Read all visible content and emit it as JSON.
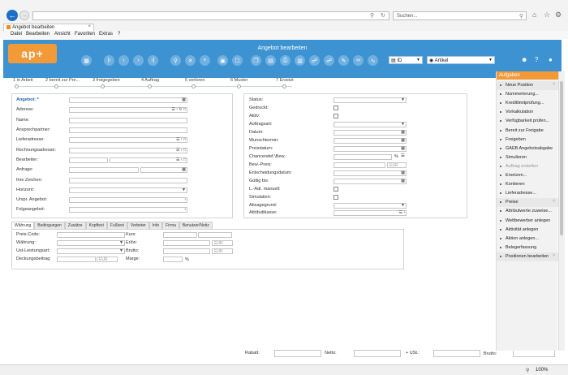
{
  "browser": {
    "search_placeholder": "Suchen...",
    "tab_title": "Angebot bearbeiten",
    "menu": [
      "Datei",
      "Bearbeiten",
      "Ansicht",
      "Favoriten",
      "Extras",
      "?"
    ],
    "zoom": "100%"
  },
  "app": {
    "logo": "ap+",
    "title": "Angebot bearbeiten",
    "id_select": "ID",
    "artikel_select": "Artikel",
    "colors": {
      "header": "#3d93d1",
      "accent": "#f29a38"
    }
  },
  "steps": [
    "1 in Arbeit",
    "2 bereit zur Pre...",
    "3 freigegeben",
    "4 Auftrag",
    "5 verloren",
    "6 Muster",
    "7 Ersetzt"
  ],
  "left_form": {
    "labels": [
      "Angebot: *",
      "Adresse:",
      "Name:",
      "Ansprechpartner:",
      "Lieferadresse:",
      "Rechnungsadresse:",
      "Bearbeiter:",
      "Anfrage:",
      "Ihre Zeichen:",
      "Horizont:",
      "Urspr. Angebot:",
      "Folgeangebot:"
    ]
  },
  "right_form": {
    "labels": [
      "Status:",
      "Gedruckt:",
      "Aktiv:",
      "Auftragsart:",
      "Datum:",
      "Wunschtermin:",
      "Preisdatum:",
      "Chancendef.\\Bew.:",
      "Bew.-Preis:",
      "Entscheidungsdatum:",
      "Gültig bis:",
      "L.-Adr. manuell:",
      "Simulation:",
      "Absagegrund:",
      "Attributklasse:"
    ],
    "percent": "%",
    "currency": "EUR"
  },
  "tabs": [
    "Währung",
    "Bedingungen",
    "Zusätze",
    "Kopftext",
    "Fußtext",
    "Verbeter",
    "Info",
    "Firma",
    "Benutzer/Notiz"
  ],
  "waehrung": {
    "left_labels": [
      "Preis-Code:",
      "Währung:",
      "Ust-Leistungsart:",
      "Deckungsbeitrag:"
    ],
    "right_labels": [
      "Kurs:",
      "Erlös:",
      "Brutto:",
      "Marge:"
    ],
    "currency": "EUR",
    "percent": "%"
  },
  "totals": {
    "labels": [
      "Rabatt:",
      "Netto:",
      "+ USt.:",
      "Brutto:"
    ]
  },
  "sidebar": {
    "title": "Aufgaben",
    "items": [
      {
        "label": "Neue Position",
        "type": "sec"
      },
      {
        "label": "Nummerierung...",
        "type": "item"
      },
      {
        "label": "Kreditlimitprüfung...",
        "type": "item"
      },
      {
        "label": "Vorkalkulation",
        "type": "item"
      },
      {
        "label": "Verfügbarkeit prüfen...",
        "type": "item"
      },
      {
        "label": "Bereit zur Freigabe",
        "type": "item"
      },
      {
        "label": "Freigeben",
        "type": "item"
      },
      {
        "label": "GAEB Angebotsabgabe",
        "type": "item"
      },
      {
        "label": "Simulieren",
        "type": "item"
      },
      {
        "label": "Auftrag erstellen",
        "type": "dis"
      },
      {
        "label": "Ersetzen...",
        "type": "item"
      },
      {
        "label": "Kontieren",
        "type": "item"
      },
      {
        "label": "Lieferadresse...",
        "type": "item"
      },
      {
        "label": "Preise",
        "type": "sec"
      },
      {
        "label": "Attributwerte zuweise...",
        "type": "item"
      },
      {
        "label": "Wettbewerber anlegen",
        "type": "item"
      },
      {
        "label": "Aktivität anlegen",
        "type": "item"
      },
      {
        "label": "Aktion anlegen...",
        "type": "item"
      },
      {
        "label": "Belegerfassung",
        "type": "item"
      },
      {
        "label": "Positionen bearbeiten",
        "type": "sec"
      }
    ]
  }
}
